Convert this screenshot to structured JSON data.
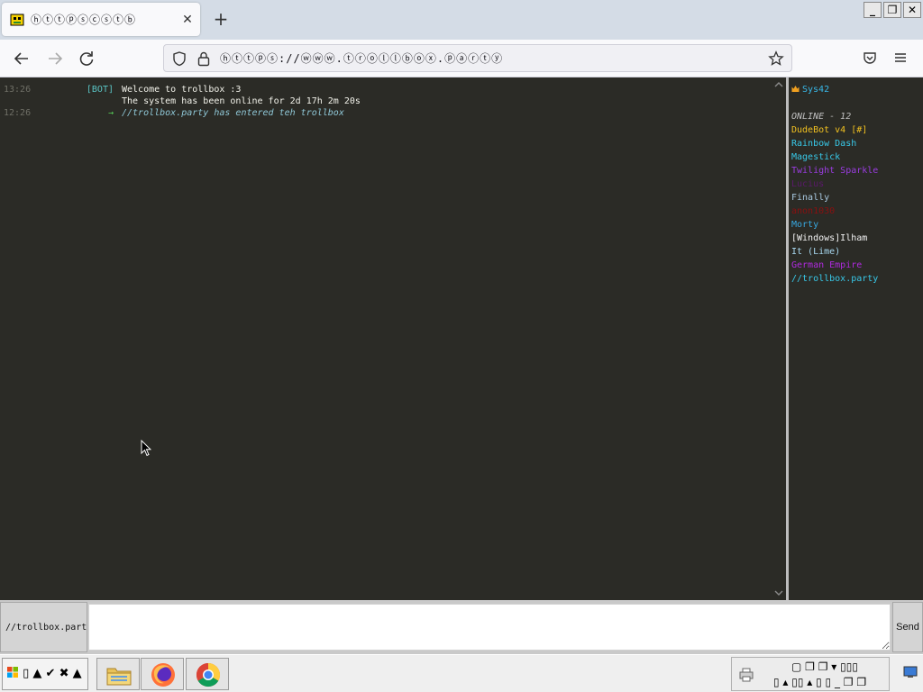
{
  "browser": {
    "tab_title": "ⓗⓣⓣⓟⓢⓒⓢⓣⓑ",
    "tab_close": "✕",
    "new_tab": "+",
    "url": "ⓗⓣⓣⓟⓢ://ⓦⓦⓦ.ⓣⓡⓞⓛⓛⓑⓞⓧ.ⓟⓐⓡⓣⓨ",
    "window_controls": {
      "minimize": "_",
      "maximize": "❐",
      "close": "✕"
    }
  },
  "chat": {
    "messages": [
      {
        "time": "13:26",
        "nick": "[BOT]",
        "text": "Welcome to trollbox :3",
        "nick_color": "#5ac4c4"
      },
      {
        "time": "",
        "nick": "",
        "text": "The system has been online for 2d 17h 2m 20s"
      },
      {
        "time": "12:26",
        "nick": "→",
        "text": "//trollbox.party has entered teh trollbox",
        "nick_color": "#58d058"
      }
    ]
  },
  "sidebar": {
    "me": "Sys42",
    "online_header": "ONLINE - 12",
    "users": [
      {
        "name": "DudeBot v4 [#]",
        "color": "#f0c020"
      },
      {
        "name": "Rainbow Dash",
        "color": "#38c8e8"
      },
      {
        "name": "Magestick",
        "color": "#38c8e8"
      },
      {
        "name": "Twilight Sparkle",
        "color": "#9a3ce0"
      },
      {
        "name": "Lucius",
        "color": "#5a1a6a"
      },
      {
        "name": "Finally",
        "color": "#a8c8e0"
      },
      {
        "name": "anon1030",
        "color": "#8a1010"
      },
      {
        "name": "Morty",
        "color": "#38a8e0"
      },
      {
        "name": "[Windows]Ilham",
        "color": "#f2f2f2"
      },
      {
        "name": "It (Lime)",
        "color": "#a8d8f0"
      },
      {
        "name": "German Empire",
        "color": "#b02ae0"
      },
      {
        "name": "//trollbox.party",
        "color": "#38c8e8"
      }
    ]
  },
  "input": {
    "nick": "//trollbox.party",
    "message_value": "",
    "send_label": "Send"
  },
  "taskbar": {
    "start_label": "▯ ▲ ✔ ✖ ▲",
    "tray_row1": "▢ ❐ ❐ ▾ ▯▯▯",
    "tray_row2": "▯ ▴ ▯▯ ▴ ▯ ▯ _ ❐ ❐"
  }
}
